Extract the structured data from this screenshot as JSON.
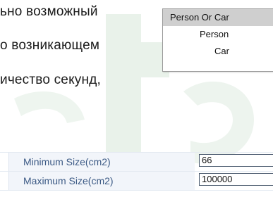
{
  "document": {
    "lines": [
      "ьно возможный",
      "о возникающем",
      "ичество секунд,"
    ]
  },
  "dropdown": {
    "items": [
      {
        "label": "Person Or Car",
        "selected": true
      },
      {
        "label": "Person",
        "selected": false
      },
      {
        "label": "Car",
        "selected": false
      }
    ]
  },
  "form": {
    "rows": [
      {
        "label": "Minimum Size(cm2)",
        "value": "66"
      },
      {
        "label": "Maximum Size(cm2)",
        "value": "100000"
      }
    ]
  },
  "colors": {
    "label_text": "#3c5a85",
    "label_bg": "#f2f5fa",
    "selected_bg": "#cfcfcf",
    "watermark": "#e6f0e8"
  }
}
